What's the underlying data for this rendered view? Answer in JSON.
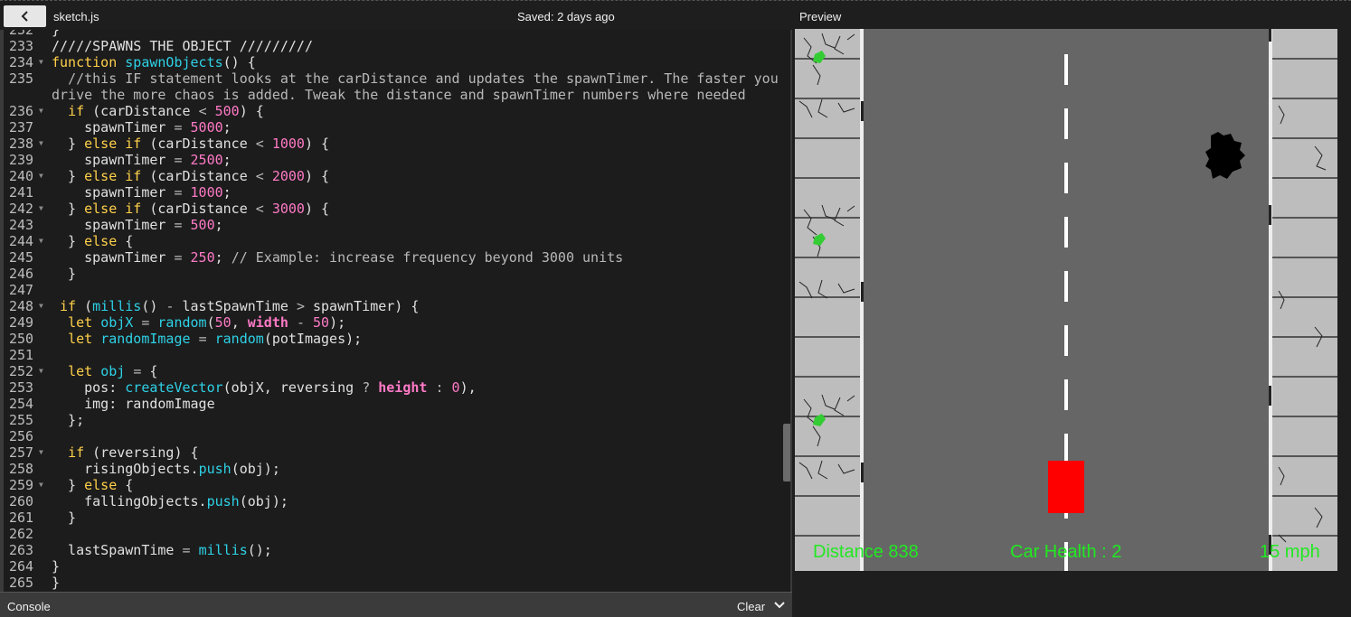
{
  "topbar": {
    "back_icon": "chevron-left-icon",
    "filename": "sketch.js",
    "status": "Saved: 2 days ago",
    "preview_label": "Preview"
  },
  "editor": {
    "lines": [
      {
        "n": "232",
        "html": "}"
      },
      {
        "n": "233",
        "html": "/////SPAWNS THE OBJECT /////////"
      },
      {
        "n": "234",
        "fold": true,
        "html": "<span class=\"k\">function</span> <span class=\"f\">spawnObjects</span>() {"
      },
      {
        "n": "235",
        "html": "  <span class=\"c\">//this IF statement looks at the carDistance and updates the spawnTimer. The faster you</span>",
        "wrap": "<span class=\"c\">drive the more chaos is added. Tweak the distance and spawnTimer numbers where needed</span>"
      },
      {
        "n": "236",
        "fold": true,
        "html": "  <span class=\"k\">if</span> (carDistance <span class=\"o\">&lt;</span> <span class=\"n\">500</span>) {"
      },
      {
        "n": "237",
        "html": "    spawnTimer <span class=\"o\">=</span> <span class=\"n\">5000</span>;"
      },
      {
        "n": "238",
        "fold": true,
        "html": "  } <span class=\"k\">else if</span> (carDistance <span class=\"o\">&lt;</span> <span class=\"n\">1000</span>) {"
      },
      {
        "n": "239",
        "html": "    spawnTimer <span class=\"o\">=</span> <span class=\"n\">2500</span>;"
      },
      {
        "n": "240",
        "fold": true,
        "html": "  } <span class=\"k\">else if</span> (carDistance <span class=\"o\">&lt;</span> <span class=\"n\">2000</span>) {"
      },
      {
        "n": "241",
        "html": "    spawnTimer <span class=\"o\">=</span> <span class=\"n\">1000</span>;"
      },
      {
        "n": "242",
        "fold": true,
        "html": "  } <span class=\"k\">else if</span> (carDistance <span class=\"o\">&lt;</span> <span class=\"n\">3000</span>) {"
      },
      {
        "n": "243",
        "html": "    spawnTimer <span class=\"o\">=</span> <span class=\"n\">500</span>;"
      },
      {
        "n": "244",
        "fold": true,
        "html": "  } <span class=\"k\">else</span> {"
      },
      {
        "n": "245",
        "html": "    spawnTimer <span class=\"o\">=</span> <span class=\"n\">250</span>; <span class=\"c\">// Example: increase frequency beyond 3000 units</span>"
      },
      {
        "n": "246",
        "html": "  }"
      },
      {
        "n": "247",
        "html": ""
      },
      {
        "n": "248",
        "fold": true,
        "html": " <span class=\"k\">if</span> (<span class=\"f\">millis</span>() <span class=\"o\">-</span> lastSpawnTime <span class=\"o\">&gt;</span> spawnTimer) {"
      },
      {
        "n": "249",
        "html": "  <span class=\"k\">let</span> <span class=\"f\">objX</span> <span class=\"o\">=</span> <span class=\"f\">random</span>(<span class=\"n\">50</span>, <span class=\"b\">width</span> <span class=\"o\">-</span> <span class=\"n\">50</span>);"
      },
      {
        "n": "250",
        "html": "  <span class=\"k\">let</span> <span class=\"f\">randomImage</span> <span class=\"o\">=</span> <span class=\"f\">random</span>(potImages);"
      },
      {
        "n": "251",
        "html": ""
      },
      {
        "n": "252",
        "fold": true,
        "html": "  <span class=\"k\">let</span> <span class=\"f\">obj</span> <span class=\"o\">=</span> {"
      },
      {
        "n": "253",
        "html": "    pos: <span class=\"f\">createVector</span>(objX, reversing <span class=\"o\">?</span> <span class=\"b\">height</span> <span class=\"o\">:</span> <span class=\"n\">0</span>),"
      },
      {
        "n": "254",
        "html": "    img: randomImage"
      },
      {
        "n": "255",
        "html": "  };"
      },
      {
        "n": "256",
        "html": ""
      },
      {
        "n": "257",
        "fold": true,
        "html": "  <span class=\"k\">if</span> (reversing) {"
      },
      {
        "n": "258",
        "html": "    risingObjects.<span class=\"f\">push</span>(obj);"
      },
      {
        "n": "259",
        "fold": true,
        "html": "  } <span class=\"k\">else</span> {"
      },
      {
        "n": "260",
        "html": "    fallingObjects.<span class=\"f\">push</span>(obj);"
      },
      {
        "n": "261",
        "html": "  }"
      },
      {
        "n": "262",
        "html": ""
      },
      {
        "n": "263",
        "html": "  lastSpawnTime <span class=\"o\">=</span> <span class=\"f\">millis</span>();"
      },
      {
        "n": "264",
        "html": "}"
      },
      {
        "n": "265",
        "html": "}"
      }
    ]
  },
  "console": {
    "label": "Console",
    "clear_label": "Clear",
    "chevron_icon": "chevron-down-icon"
  },
  "preview": {
    "distance_text": "Distance 838",
    "health_text": "Car Health : 2",
    "speed_text": "15 mph",
    "colors": {
      "road": "#666666",
      "sidewalk": "#bdbdbd",
      "car": "#ff0000",
      "hud": "#22e822"
    }
  }
}
